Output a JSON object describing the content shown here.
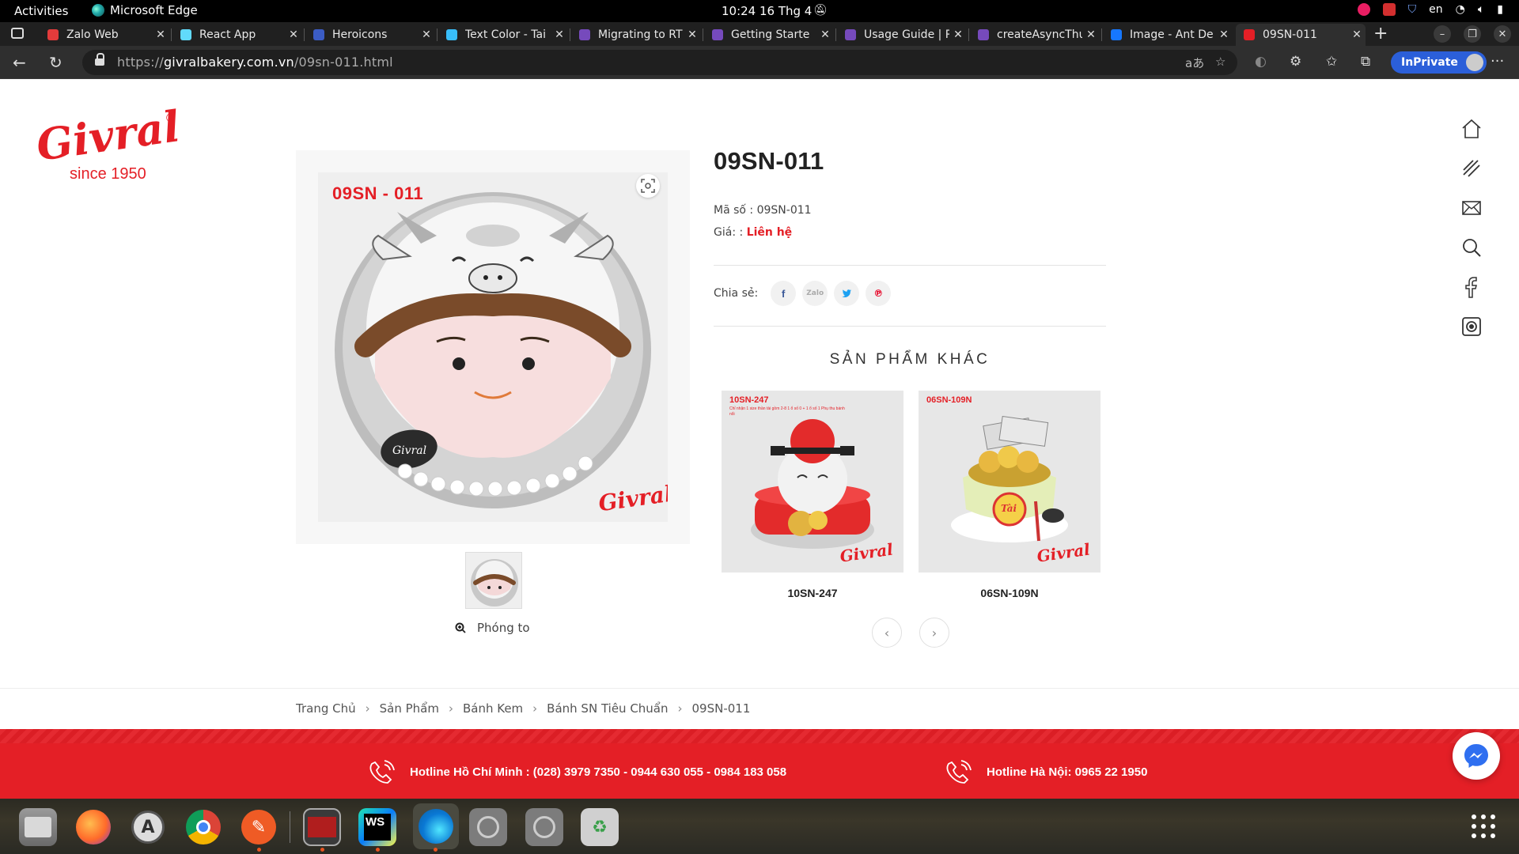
{
  "system_bar": {
    "activities": "Activities",
    "app_name": "Microsoft Edge",
    "clock": "10:24  16 Thg 4",
    "language": "en"
  },
  "tabs": [
    {
      "title": "Zalo Web",
      "favicon_color": "#e33b3b"
    },
    {
      "title": "React App",
      "favicon_color": "#61dafb"
    },
    {
      "title": "Heroicons",
      "favicon_color": "#3b5cc4"
    },
    {
      "title": "Text Color - Tai",
      "favicon_color": "#38bdf8"
    },
    {
      "title": "Migrating to RT",
      "favicon_color": "#764abc"
    },
    {
      "title": "Getting Starte",
      "favicon_color": "#764abc"
    },
    {
      "title": "Usage Guide | R",
      "favicon_color": "#764abc"
    },
    {
      "title": "createAsyncThu",
      "favicon_color": "#764abc"
    },
    {
      "title": "Image - Ant De",
      "favicon_color": "#1677ff"
    },
    {
      "title": "09SN-011",
      "favicon_color": "#e41f26",
      "active": true
    }
  ],
  "address_bar": {
    "url_scheme": "https://",
    "url_host": "givralbakery.com.vn",
    "url_path": "/09sn-011.html",
    "inprivate_label": "InPrivate"
  },
  "brand": {
    "logo_text": "Givral",
    "since": "since 1950",
    "registered": "®",
    "accent_color": "#e41f26"
  },
  "product": {
    "title": "09SN-011",
    "code_label": "Mã số :",
    "code_value": "09SN-011",
    "price_label": "Giá: :",
    "price_value": "Liên hệ",
    "image_code": "09SN - 011",
    "zoom_label": "Phóng to"
  },
  "share": {
    "label": "Chia sẻ:",
    "networks": [
      "facebook-icon",
      "zalo-icon",
      "twitter-icon",
      "pinterest-icon"
    ],
    "zalo_text": "Zalo"
  },
  "related": {
    "heading": "SẢN PHẨM KHÁC",
    "items": [
      {
        "name": "10SN-247",
        "image_code": "10SN-247",
        "image_note": "Chỉ nhận 1 size thần tài gồm 2-8 1 ổ số 0 + 1 ổ số 1 Phụ thu bánh nổi"
      },
      {
        "name": "06SN-109N",
        "image_code": "06SN-109N",
        "bag_text": "Tài"
      }
    ]
  },
  "breadcrumb": [
    "Trang Chủ",
    "Sản Phẩm",
    "Bánh Kem",
    "Bánh SN Tiêu Chuẩn",
    "09SN-011"
  ],
  "breadcrumb_sep": "›",
  "hotlines": {
    "hcm": "Hotline Hồ Chí Minh : (028) 3979 7350 - 0944 630 055 - 0984 183 058",
    "hanoi": "Hotline Hà Nội: 0965 22 1950"
  },
  "right_nav_icons": [
    "home-icon",
    "menu-icon",
    "mail-icon",
    "search-icon",
    "facebook-icon",
    "instagram-icon"
  ],
  "dock_apps": [
    "files-icon",
    "firefox-icon",
    "software-center-icon",
    "chrome-icon",
    "postman-icon",
    "terminal-icon",
    "webstorm-icon",
    "edge-icon",
    "disk-icon",
    "disk-icon",
    "trash-icon"
  ]
}
